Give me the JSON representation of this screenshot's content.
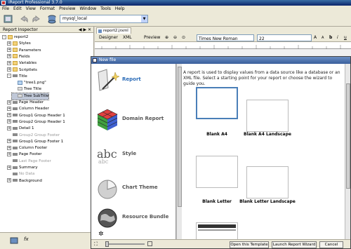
{
  "window": {
    "title": "iReport Professional 3.7.0"
  },
  "menu": [
    "File",
    "Edit",
    "View",
    "Format",
    "Preview",
    "Window",
    "Tools",
    "Help"
  ],
  "toolbar": {
    "datasource": "mysql_local"
  },
  "inspector": {
    "title": "Report Inspector",
    "items": [
      {
        "label": "report2",
        "icon": "report-icon",
        "level": 0,
        "expander": "-"
      },
      {
        "label": "Styles",
        "icon": "styles-icon",
        "level": 1,
        "expander": "+"
      },
      {
        "label": "Parameters",
        "icon": "parameters-icon",
        "level": 1,
        "expander": "+"
      },
      {
        "label": "Fields",
        "icon": "fields-icon",
        "level": 1,
        "expander": "+"
      },
      {
        "label": "Variables",
        "icon": "variables-icon",
        "level": 1,
        "expander": "+"
      },
      {
        "label": "Scriptlets",
        "icon": "scriptlets-icon",
        "level": 1,
        "expander": "+"
      },
      {
        "label": "Title",
        "icon": "band-icon",
        "level": 1,
        "expander": "-"
      },
      {
        "label": "\"tree1.png\"",
        "icon": "image-icon",
        "level": 2,
        "expander": ""
      },
      {
        "label": "Tree Title",
        "icon": "text-icon",
        "level": 2,
        "expander": ""
      },
      {
        "label": "Tree SubTitle",
        "icon": "text-icon",
        "level": 2,
        "expander": "",
        "selected": true
      },
      {
        "label": "Page Header",
        "icon": "band-icon",
        "level": 1,
        "expander": "+"
      },
      {
        "label": "Column Header",
        "icon": "band-icon",
        "level": 1,
        "expander": "+"
      },
      {
        "label": "Group1 Group Header 1",
        "icon": "band-icon",
        "level": 1,
        "expander": "+"
      },
      {
        "label": "Group2 Group Header 1",
        "icon": "band-icon",
        "level": 1,
        "expander": "+"
      },
      {
        "label": "Detail 1",
        "icon": "band-icon",
        "level": 1,
        "expander": "+"
      },
      {
        "label": "Group2 Group Footer",
        "icon": "band-icon",
        "level": 1,
        "expander": "",
        "disabled": true
      },
      {
        "label": "Group1 Group Footer 1",
        "icon": "band-icon",
        "level": 1,
        "expander": "+"
      },
      {
        "label": "Column Footer",
        "icon": "band-icon",
        "level": 1,
        "expander": "+"
      },
      {
        "label": "Page Footer",
        "icon": "band-icon",
        "level": 1,
        "expander": "+"
      },
      {
        "label": "Last Page Footer",
        "icon": "band-icon",
        "level": 1,
        "expander": "",
        "disabled": true
      },
      {
        "label": "Summary",
        "icon": "band-icon",
        "level": 1,
        "expander": "+"
      },
      {
        "label": "No Data",
        "icon": "band-icon",
        "level": 1,
        "expander": "",
        "disabled": true
      },
      {
        "label": "Background",
        "icon": "band-icon",
        "level": 1,
        "expander": "+"
      }
    ]
  },
  "editor": {
    "tab": "report2.jrxml",
    "designer": "Designer",
    "xml": "XML",
    "preview": "Preview",
    "font": "Times New Roman",
    "font_size": "22"
  },
  "dialog": {
    "title": "New file",
    "categories": [
      {
        "label": "Report",
        "active": true
      },
      {
        "label": "Domain Report"
      },
      {
        "label": "Style"
      },
      {
        "label": "Chart Theme"
      },
      {
        "label": "Resource Bundle"
      }
    ],
    "description": "A report is used to display values from a data source like a database or an XML file. Select a starting point for your report or choose the wizard to guide you.",
    "templates": [
      {
        "label": "Blank A4",
        "selected": true
      },
      {
        "label": "Blank A4 Landscape"
      },
      {
        "label": "Blank Letter"
      },
      {
        "label": "Blank Letter Landscape"
      }
    ],
    "buttons": {
      "open": "Open this Template",
      "wizard": "Launch Report Wizard",
      "cancel": "Cancel"
    }
  }
}
